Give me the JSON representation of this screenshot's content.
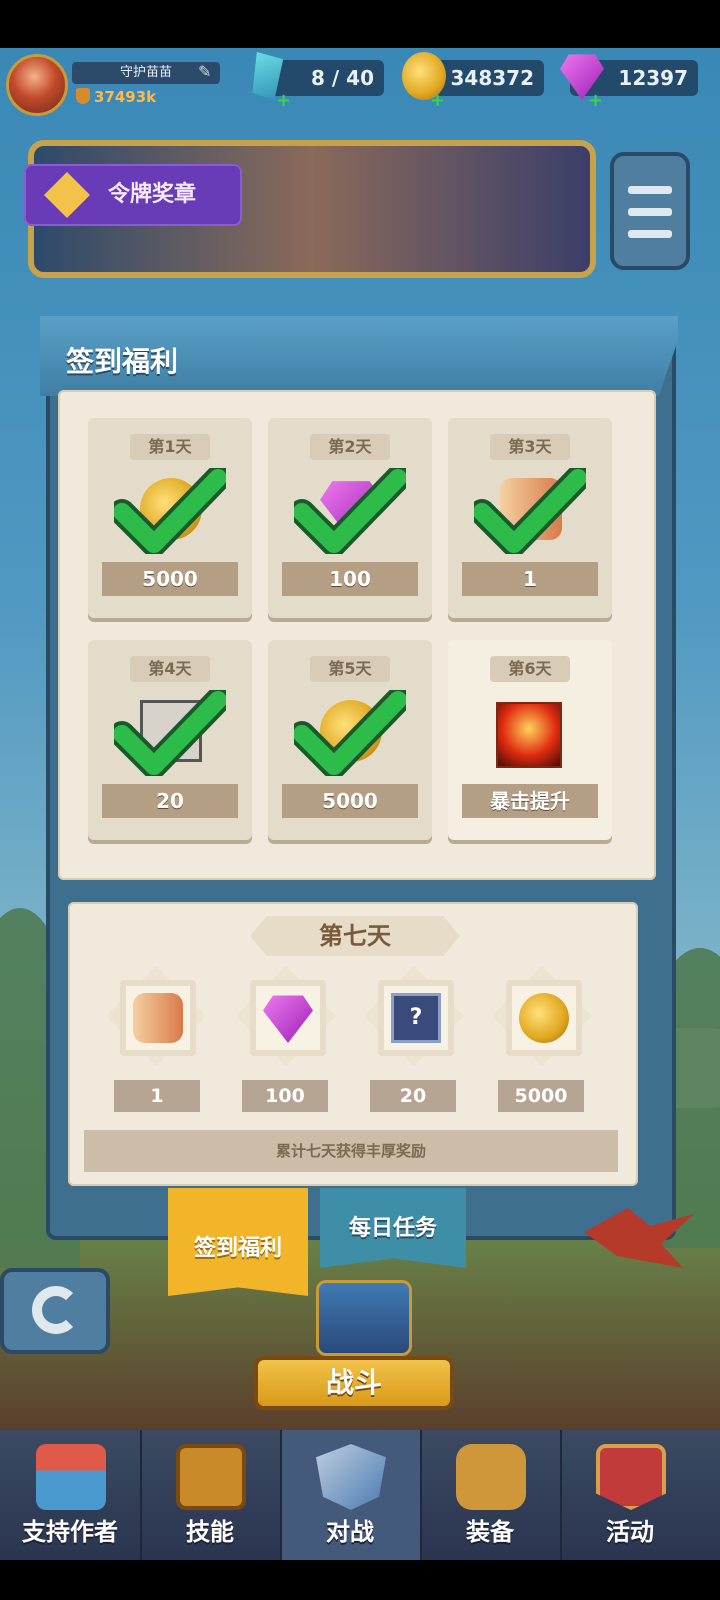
{
  "player": {
    "name": "守护苗苗",
    "power": "37493k"
  },
  "resources": {
    "energy": "8 / 40",
    "coins": "348372",
    "gems": "12397"
  },
  "banner": {
    "tag_label": "令牌奖章"
  },
  "panel": {
    "title": "签到福利",
    "days": [
      {
        "label": "第1天",
        "amount": "5000",
        "item": "coin-icon",
        "claimed": true
      },
      {
        "label": "第2天",
        "amount": "100",
        "item": "gem-icon",
        "claimed": true
      },
      {
        "label": "第3天",
        "amount": "1",
        "item": "scroll-icon",
        "claimed": true
      },
      {
        "label": "第4天",
        "amount": "20",
        "item": "chip-icon",
        "claimed": true
      },
      {
        "label": "第5天",
        "amount": "5000",
        "item": "coin-icon",
        "claimed": true
      },
      {
        "label": "第6天",
        "amount": "暴击提升",
        "item": "critical-boost-icon",
        "claimed": false
      }
    ],
    "week": {
      "title": "第七天",
      "rewards": [
        {
          "amount": "1",
          "item": "scroll-icon"
        },
        {
          "amount": "100",
          "item": "gem-icon"
        },
        {
          "amount": "20",
          "item": "mystery-box-icon"
        },
        {
          "amount": "5000",
          "item": "coin-icon"
        }
      ],
      "footer": "累计七天获得丰厚奖励"
    }
  },
  "tabs": {
    "checkin": "签到福利",
    "daily": "每日任务"
  },
  "battle_button": "战斗",
  "nav": [
    {
      "label": "支持作者",
      "icon": "shop-icon"
    },
    {
      "label": "技能",
      "icon": "skill-book-icon"
    },
    {
      "label": "对战",
      "icon": "battle-swords-icon",
      "active": true
    },
    {
      "label": "装备",
      "icon": "backpack-icon"
    },
    {
      "label": "活动",
      "icon": "event-badge-icon"
    }
  ],
  "colors": {
    "accent_gold": "#f2b52a",
    "panel_blue": "#3f6f8e",
    "paper": "#f1eadc",
    "check_green": "#2dbb4a"
  }
}
